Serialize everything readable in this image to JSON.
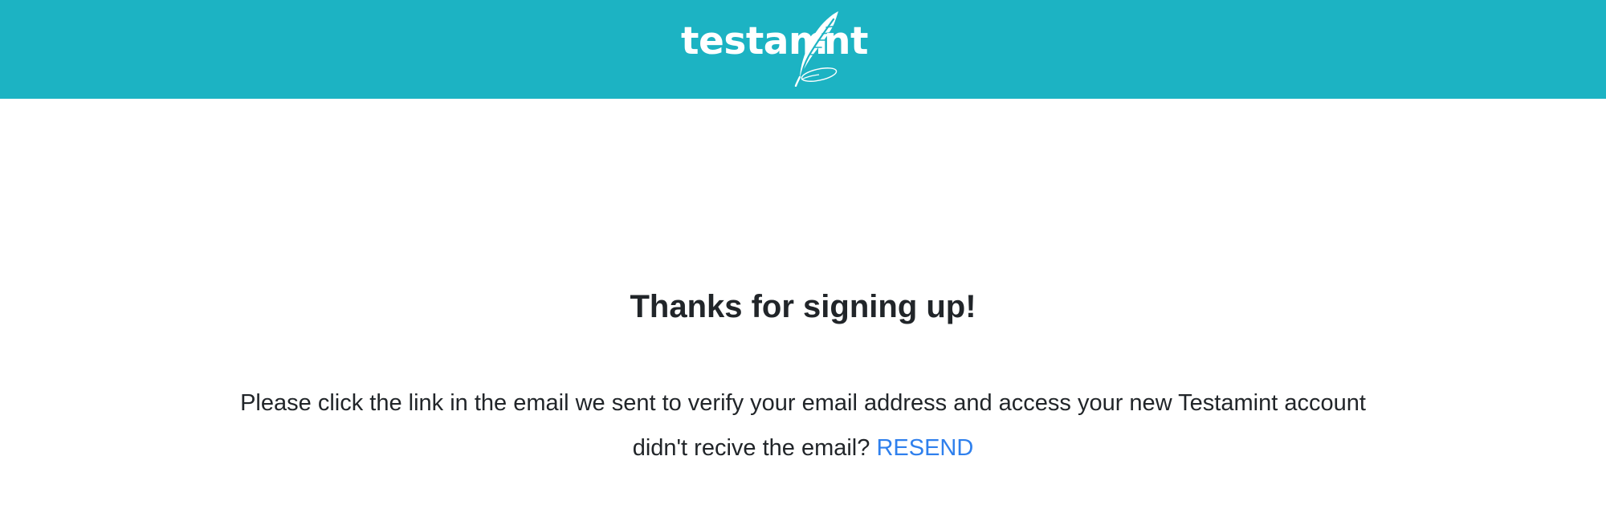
{
  "header": {
    "logo": {
      "text_left": "testam",
      "text_right": "nt",
      "icon": "quill-feather-icon",
      "alt": "testamint"
    },
    "background_color": "#1cb3c3"
  },
  "main": {
    "title": "Thanks for signing up!",
    "message": "Please click the link in the email we sent to verify your email address and access your new Testamint account",
    "resend_prompt": "didn't recive the email?",
    "resend_label": "RESEND"
  },
  "colors": {
    "accent": "#1cb3c3",
    "link": "#2f80ed",
    "text": "#212529"
  }
}
